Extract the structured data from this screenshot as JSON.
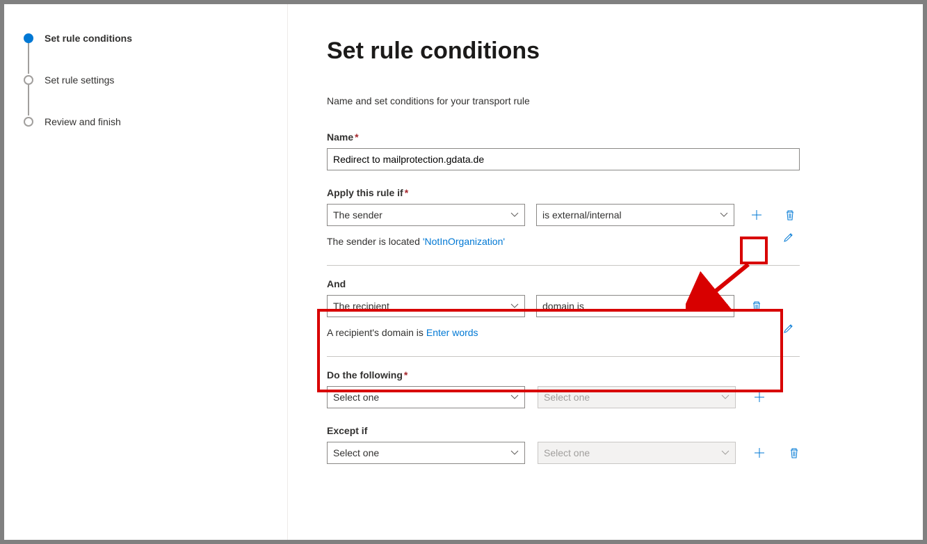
{
  "sidebar": {
    "steps": [
      {
        "label": "Set rule conditions",
        "active": true
      },
      {
        "label": "Set rule settings",
        "active": false
      },
      {
        "label": "Review and finish",
        "active": false
      }
    ]
  },
  "main": {
    "heading": "Set rule conditions",
    "intro": "Name and set conditions for your transport rule",
    "name_label": "Name",
    "name_value": "Redirect to mailprotection.gdata.de",
    "apply_label": "Apply this rule if",
    "condition1": {
      "dd1": "The sender",
      "dd2": "is external/internal",
      "summary_prefix": "The sender is located ",
      "summary_link": "'NotInOrganization'"
    },
    "and_label": "And",
    "condition2": {
      "dd1": "The recipient",
      "dd2": "domain is",
      "summary_prefix": "A recipient's domain is ",
      "summary_link": "Enter words"
    },
    "do_label": "Do the following",
    "select_one": "Select one",
    "except_label": "Except if"
  }
}
